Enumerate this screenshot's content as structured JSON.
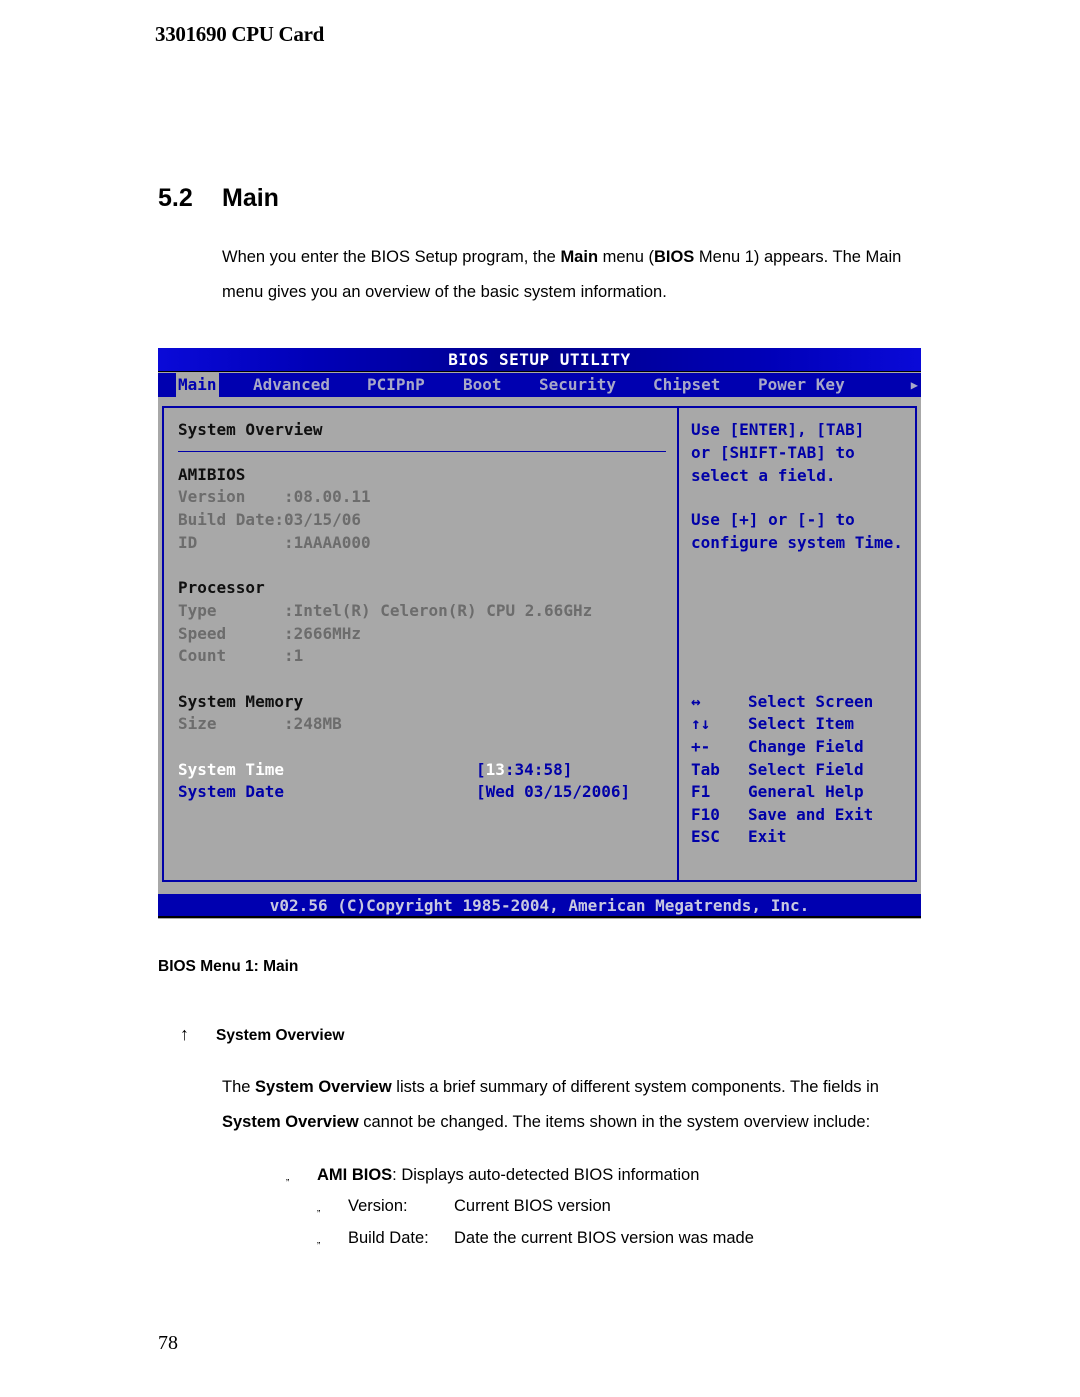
{
  "document": {
    "header": "3301690 CPU Card",
    "section_number": "5.2",
    "section_title": "Main",
    "intro_parts": {
      "p1": "When you enter the BIOS Setup program, the ",
      "b1": "Main",
      "p2": " menu (",
      "b2": "BIOS",
      "p3": " Menu 1) appears. The Main menu gives you an overview of the basic system information."
    },
    "caption": "BIOS Menu 1: Main",
    "bullet_glyph": "↑",
    "bullet_heading": "System Overview",
    "body_parts": {
      "p1": "The ",
      "b1": "System Overview",
      "p2": " lists a brief summary of different system components. The fields in ",
      "b2": "System Overview",
      "p3": " cannot be changed. The items shown in the system overview include:"
    },
    "list": {
      "mark": "„",
      "ami_label": "AMI BIOS",
      "ami_desc": ": Displays auto-detected BIOS information",
      "version_label": "Version:",
      "version_desc": "Current BIOS version",
      "build_label": "Build Date:",
      "build_desc": "Date the current BIOS version was made"
    },
    "page_number": "78"
  },
  "bios": {
    "title": "BIOS SETUP UTILITY",
    "menu": [
      "Main",
      "Advanced",
      "PCIPnP",
      "Boot",
      "Security",
      "Chipset",
      "Power Key"
    ],
    "active_menu": "Main",
    "more_arrow": "▶",
    "overview_heading": "System Overview",
    "amibios_heading": "AMIBIOS",
    "version": "Version    :08.00.11",
    "build_date": "Build Date:03/15/06",
    "id": "ID         :1AAAA000",
    "processor_heading": "Processor",
    "type": "Type       :Intel(R) Celeron(R) CPU 2.66GHz",
    "speed": "Speed      :2666MHz",
    "count": "Count      :1",
    "memory_heading": "System Memory",
    "size": "Size       :248MB",
    "system_time_label": "System Time",
    "system_time_selected": "13",
    "system_time_rest": ":34:58]",
    "system_time_open": "[",
    "system_date_label": "System Date",
    "system_date_value": "[Wed 03/15/2006]",
    "help_lines": [
      "Use [ENTER], [TAB]",
      "or [SHIFT-TAB] to",
      "select a field.",
      "",
      "Use [+] or [-] to",
      "configure system Time."
    ],
    "keys": [
      {
        "key": "↔",
        "action": "Select Screen"
      },
      {
        "key": "↑↓",
        "action": "Select Item"
      },
      {
        "key": "+-",
        "action": "Change Field"
      },
      {
        "key": "Tab",
        "action": "Select Field"
      },
      {
        "key": "F1",
        "action": "General Help"
      },
      {
        "key": "F10",
        "action": "Save and Exit"
      },
      {
        "key": "ESC",
        "action": "Exit"
      }
    ],
    "footer": "v02.56 (C)Copyright 1985-2004, American Megatrends, Inc.",
    "colors": {
      "title_bar": "#0000b8",
      "menu_bar": "#0000b0",
      "panel_bg": "#a8a8a8",
      "border": "#0000a8",
      "help_text": "#0000a8",
      "value_text": "#6c6c6c"
    }
  }
}
